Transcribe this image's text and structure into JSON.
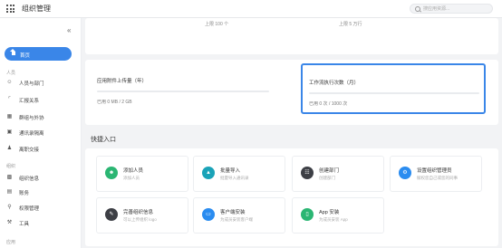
{
  "app": {
    "title": "组织管理"
  },
  "search": {
    "placeholder": "搜应用资源..."
  },
  "sidebar": {
    "collapse_icon": "«",
    "home": "首页",
    "sections": [
      {
        "title": "人员",
        "items": [
          {
            "label": "人员与部门",
            "icon": "people-icon"
          },
          {
            "label": "汇报关系",
            "icon": "org-chart-icon"
          },
          {
            "label": "群组与外协",
            "icon": "group-icon"
          },
          {
            "label": "通讯录隔离",
            "icon": "isolation-icon"
          },
          {
            "label": "离职交接",
            "icon": "handover-icon"
          }
        ]
      },
      {
        "title": "组织",
        "items": [
          {
            "label": "组织信息",
            "icon": "building-icon"
          },
          {
            "label": "账务",
            "icon": "account-icon"
          },
          {
            "label": "权限管理",
            "icon": "key-icon"
          },
          {
            "label": "工具",
            "icon": "wrench-icon"
          }
        ]
      },
      {
        "title": "应用",
        "items": []
      }
    ]
  },
  "usage_top": {
    "left": "上限 100 个",
    "right": "上限 5 万行"
  },
  "usage": {
    "storage": {
      "title": "应用附件上传量（年）",
      "text": "已用 0 MB / 2 GB",
      "fill": 0
    },
    "workflow": {
      "title": "工作流执行次数（月）",
      "text": "已用 0 次 / 1000 次",
      "fill": 0
    }
  },
  "quick_access": {
    "title": "快捷入口",
    "tiles": [
      {
        "title": "添加人员",
        "desc": "添加人员",
        "color": "#2bb673",
        "icon": "add-person-icon"
      },
      {
        "title": "批量导入",
        "desc": "批量导入通讯录",
        "color": "#1aa3b8",
        "icon": "import-icon"
      },
      {
        "title": "创建部门",
        "desc": "创建部门",
        "color": "#3d3f45",
        "icon": "department-icon"
      },
      {
        "title": "设置组织管理员",
        "desc": "赋权您自己或您的同事",
        "color": "#2a8cf0",
        "icon": "settings-icon"
      },
      {
        "title": "完善组织信息",
        "desc": "可以上传组织 logo",
        "color": "#3d3f45",
        "icon": "edit-icon"
      },
      {
        "title": "客户端安装",
        "desc": "为成员安装客户端",
        "color": "#2a8cf0",
        "icon": "desktop-icon"
      },
      {
        "title": "App 安装",
        "desc": "为成员安装 App",
        "color": "#2bb673",
        "icon": "mobile-icon"
      }
    ]
  }
}
